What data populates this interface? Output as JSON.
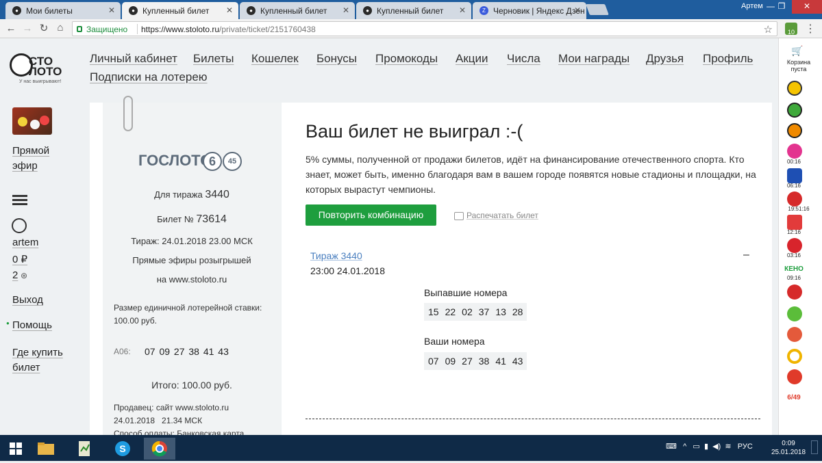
{
  "browser": {
    "tabs": [
      {
        "label": "Мои билеты",
        "active": false
      },
      {
        "label": "Купленный билет",
        "active": true
      },
      {
        "label": "Купленный билет",
        "active": false
      },
      {
        "label": "Купленный билет",
        "active": false
      },
      {
        "label": "Черновик | Яндекс Дзен",
        "active": false
      }
    ],
    "window_user": "Артем",
    "secure_label": "Защищено",
    "url_host": "https://www.stoloto.ru",
    "url_path": "/private/ticket/2151760438",
    "extension_badge": "10"
  },
  "logo": {
    "line1": "СТО",
    "line2": "ЛОТО",
    "slogan": "У нас выигрывают!"
  },
  "nav": [
    "Личный кабинет",
    "Билеты",
    "Кошелек",
    "Бонусы",
    "Промокоды",
    "Акции",
    "Числа",
    "Мои награды",
    "Друзья",
    "Профиль",
    "Подписки на лотерею"
  ],
  "sidebar": {
    "live_line1": "Прямой",
    "live_line2": "эфир",
    "username": "artem",
    "balance": "0 ₽",
    "bonus": "2",
    "logout": "Выход",
    "help": "Помощь",
    "where_buy_line1": "Где купить",
    "where_buy_line2": "билет"
  },
  "ticket": {
    "brand": "ГОСЛОТО",
    "brand_num1": "6",
    "brand_num2": "45",
    "draw_label": "Для тиража",
    "draw_no": "3440",
    "ticket_label": "Билет №",
    "ticket_no": "73614",
    "draw_datetime": "Тираж: 24.01.2018 23.00 МСК",
    "broadcast_line1": "Прямые эфиры розыгрышей",
    "broadcast_line2": "на www.stoloto.ru",
    "stake_line1": "Размер единичной лотерейной ставки:",
    "stake_line2": "100.00 руб.",
    "combo_code": "А06:",
    "combo_numbers": "07 09 27 38 41 43",
    "total": "Итого: 100.00 руб.",
    "seller": "Продавец: сайт www.stoloto.ru",
    "sold_at": "24.01.2018   21.34 МСК",
    "payment": "Способ оплаты: Банковская карта"
  },
  "result": {
    "heading": "Ваш билет не выиграл :-(",
    "text": "5% суммы, полученной от продажи билетов, идёт на финансирование отечественного спорта. Кто знает, может быть, именно благодаря вам в вашем городе появятся новые стадионы и площадки, на которых вырастут чемпионы.",
    "repeat_button": "Повторить комбинацию",
    "print_link": "Распечатать билет",
    "draw_link": "Тираж 3440",
    "draw_time": "23:00 24.01.2018",
    "collapse": "–",
    "drawn_label": "Выпавшие номера",
    "drawn_numbers": [
      "15",
      "22",
      "02",
      "37",
      "13",
      "28"
    ],
    "yours_label": "Ваши номера",
    "your_numbers": [
      "07",
      "09",
      "27",
      "38",
      "41",
      "43"
    ]
  },
  "extension_panel": {
    "cart": "Корзина пуста",
    "timers": [
      "00:16",
      "06:16",
      "19:51:16",
      "12:16",
      "03:16",
      "09:16"
    ],
    "keno": "КЕНО",
    "sport": "6/49"
  },
  "taskbar": {
    "lang": "РУС",
    "time": "0:09",
    "date": "25.01.2018"
  },
  "colors": {
    "accent_green": "#1e9e3e",
    "link_blue": "#4a7fbf",
    "chrome_blue": "#1f5d9e",
    "taskbar": "#0f2a47"
  }
}
